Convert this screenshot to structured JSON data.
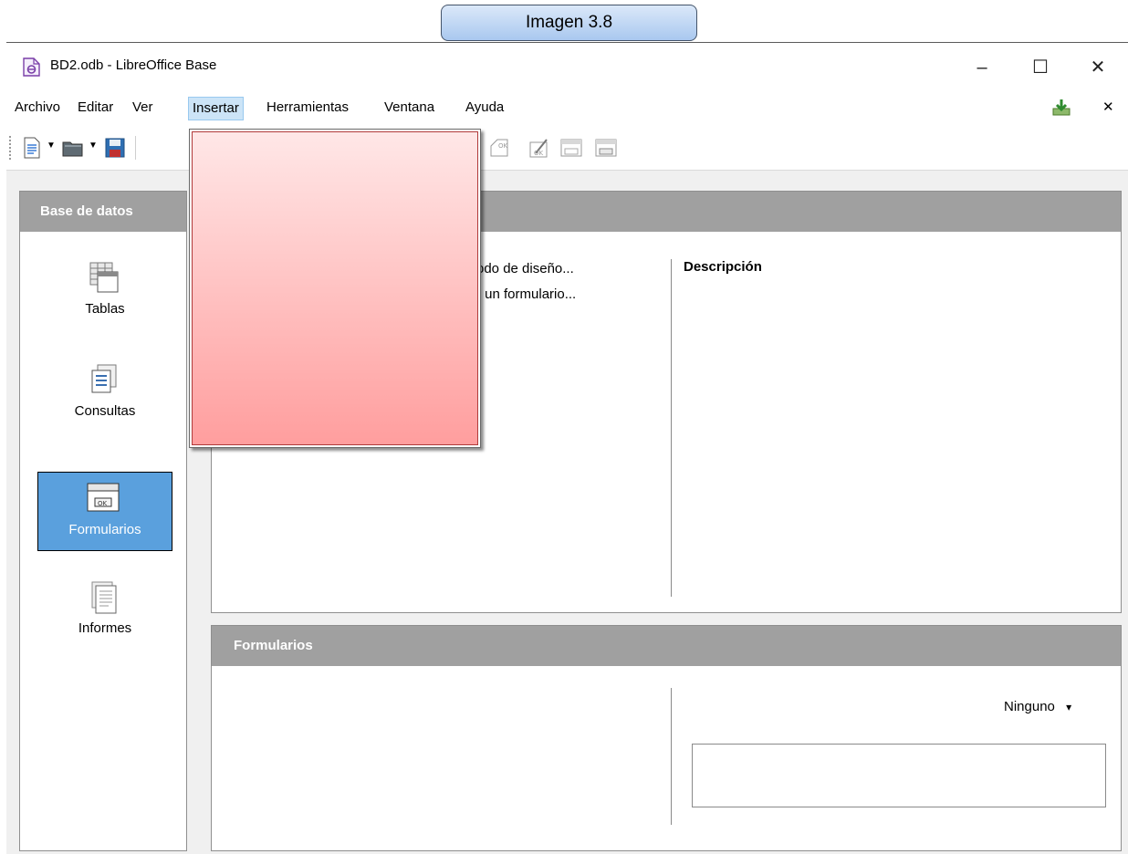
{
  "caption": "Imagen 3.8",
  "window": {
    "title": "BD2.odb - LibreOffice Base",
    "controls": {
      "minimize": "–",
      "maximize": "☐",
      "close": "✕"
    }
  },
  "menu": {
    "items": [
      {
        "label": "Archivo"
      },
      {
        "label": "Editar"
      },
      {
        "label": "Ver"
      },
      {
        "label": "Insertar"
      },
      {
        "label": "Herramientas"
      },
      {
        "label": "Ventana"
      },
      {
        "label": "Ayuda"
      }
    ],
    "active": "Insertar",
    "close_doc": "✕"
  },
  "left_panel": {
    "header": "Base de datos",
    "items": [
      {
        "label": "Tablas",
        "icon": "table-icon"
      },
      {
        "label": "Consultas",
        "icon": "query-icon"
      },
      {
        "label": "Formularios",
        "icon": "form-icon",
        "selected": true
      },
      {
        "label": "Informes",
        "icon": "report-icon"
      }
    ]
  },
  "tasks": {
    "items": [
      {
        "label": "odo de diseño..."
      },
      {
        "label": "r un formulario..."
      }
    ],
    "description_title": "Descripción"
  },
  "forms_panel": {
    "header": "Formularios",
    "preview_select": "Ninguno",
    "preview_arrow": "▾"
  },
  "colors": {
    "panel_header": "#a0a0a0",
    "selected_nav": "#5aa0dd",
    "menu_active": "#cce4f7",
    "caption_top": "#dbe8f9",
    "caption_bottom": "#a9c8ef",
    "redaction_top": "#ffe7e7",
    "redaction_bottom": "#ff9e9e"
  }
}
